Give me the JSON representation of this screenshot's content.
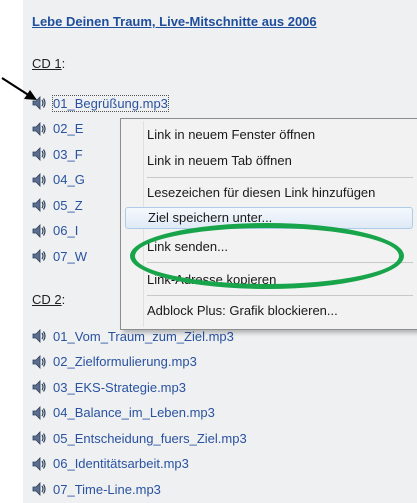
{
  "page": {
    "title": "Lebe Deinen Traum, Live-Mitschnitte aus 2006",
    "cd1_heading": "CD 1",
    "cd2_heading": "CD 2",
    "heading_suffix": ":"
  },
  "cd1_tracks": [
    "01_Begrüßung.mp3",
    "02_E",
    "03_F",
    "04_G",
    "05_Z",
    "06_I",
    "07_W"
  ],
  "cd2_tracks": [
    "01_Vom_Traum_zum_Ziel.mp3",
    "02_Zielformulierung.mp3",
    "03_EKS-Strategie.mp3",
    "04_Balance_im_Leben.mp3",
    "05_Entscheidung_fuers_Ziel.mp3",
    "06_Identitätsarbeit.mp3",
    "07_Time-Line.mp3"
  ],
  "context_menu": {
    "items": [
      "Link in neuem Fenster öffnen",
      "Link in neuem Tab öffnen",
      "Lesezeichen für diesen Link hinzufügen",
      "Ziel speichern unter...",
      "Link senden...",
      "Link-Adresse kopieren",
      "Adblock Plus: Grafik blockieren..."
    ],
    "highlighted_item": "Ziel speichern unter..."
  },
  "colors": {
    "link": "#2a52a0",
    "highlight_ellipse": "#18a44a"
  },
  "icons": {
    "track": "speaker-icon",
    "pointer": "arrow-icon"
  }
}
